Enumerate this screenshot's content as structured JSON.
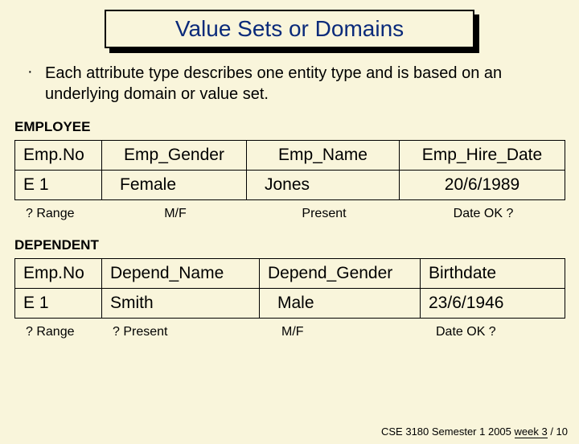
{
  "title": "Value Sets or Domains",
  "bullet": "Each attribute type describes one entity type and is based on an underlying domain or value set.",
  "employee": {
    "label": "EMPLOYEE",
    "headers": [
      "Emp.No",
      "Emp_Gender",
      "Emp_Name",
      "Emp_Hire_Date"
    ],
    "row": [
      "E 1",
      "Female",
      "Jones",
      "20/6/1989"
    ],
    "notes": [
      "? Range",
      "M/F",
      "Present",
      "Date OK ?"
    ]
  },
  "dependent": {
    "label": "DEPENDENT",
    "headers": [
      "Emp.No",
      "Depend_Name",
      "Depend_Gender",
      "Birthdate"
    ],
    "row": [
      "E 1",
      "Smith",
      "Male",
      "23/6/1946"
    ],
    "notes": [
      "? Range",
      "? Present",
      "M/F",
      "Date OK ?"
    ]
  },
  "footer": {
    "left": "CSE 3180 Semester 1 2005 ",
    "week": "week 3",
    "right": " / 10"
  }
}
